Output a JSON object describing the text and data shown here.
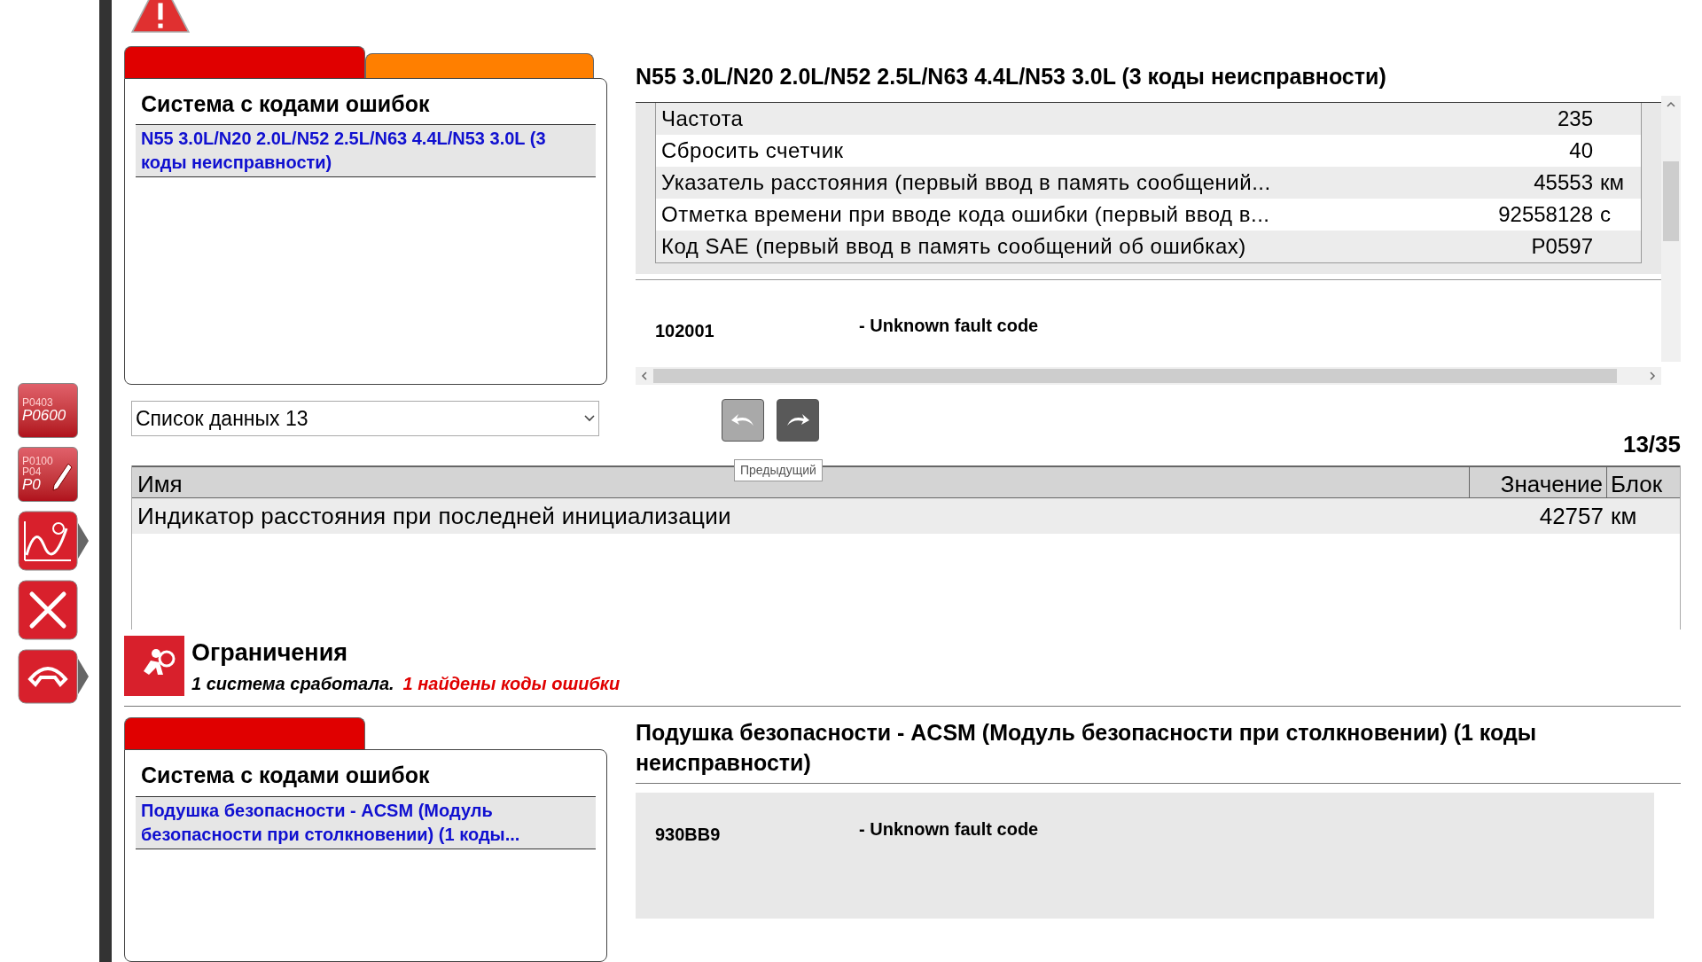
{
  "side_tools": [
    {
      "kind": "codes",
      "lines": [
        "P0403",
        "P0600"
      ],
      "has_arrow": false
    },
    {
      "kind": "codes_edit",
      "lines": [
        "P0100",
        "P04",
        "P0"
      ],
      "has_arrow": false
    },
    {
      "kind": "chart",
      "has_arrow": true
    },
    {
      "kind": "tools",
      "has_arrow": false
    },
    {
      "kind": "phone",
      "has_arrow": true
    }
  ],
  "top_section": {
    "tabs": [
      {
        "color": "#e00000",
        "selected": true
      },
      {
        "color": "#ff7f00",
        "selected": false
      }
    ],
    "panel_title": "Система с кодами ошибок",
    "items": [
      {
        "text": "N55 3.0L/N20 2.0L/N52 2.5L/N63 4.4L/N53 3.0L (3 коды неисправности)",
        "selected": true
      }
    ],
    "detail_title": "N55 3.0L/N20 2.0L/N52 2.5L/N63 4.4L/N53 3.0L (3 коды неисправности)",
    "detail_rows": [
      {
        "name": "Частота",
        "value": "235"
      },
      {
        "name": "Сбросить счетчик",
        "value": "40"
      },
      {
        "name": "Указатель расстояния (первый ввод в память сообщений...",
        "value": "45553",
        "unit": "км"
      },
      {
        "name": "Отметка времени при вводе кода ошибки (первый ввод в...",
        "value": "92558128",
        "unit": "с"
      },
      {
        "name": "Код SAE (первый ввод в память сообщений об ошибках)",
        "value": "P0597"
      }
    ],
    "faults": [
      {
        "code": "102001",
        "description": "- Unknown fault code"
      }
    ]
  },
  "data_list": {
    "dropdown": "Список данных 13",
    "buttons": [
      {
        "kind": "back"
      },
      {
        "kind": "forward"
      }
    ],
    "tooltip": "Предыдущий",
    "counter": "13/35",
    "columns": [
      "Имя",
      "Значение",
      "Блок"
    ],
    "rows": [
      {
        "name": "Индикатор расстояния при последней инициализации",
        "value": "42757",
        "unit": "км"
      }
    ]
  },
  "restrictions": {
    "title": "Ограничения",
    "summary": "1 система сработала.",
    "found": "1 найдены коды ошибки"
  },
  "bottom_section": {
    "tabs": [
      {
        "color": "#e00000",
        "selected": true
      }
    ],
    "panel_title": "Система с кодами ошибок",
    "items": [
      {
        "text": "Подушка безопасности - ACSM (Модуль безопасности при столкновении) (1 коды...",
        "selected": true
      }
    ],
    "detail_title": "Подушка безопасности - ACSM (Модуль безопасности при столкновении) (1 коды неисправности)",
    "faults": [
      {
        "code": "930BB9",
        "description": "- Unknown fault code"
      }
    ]
  }
}
